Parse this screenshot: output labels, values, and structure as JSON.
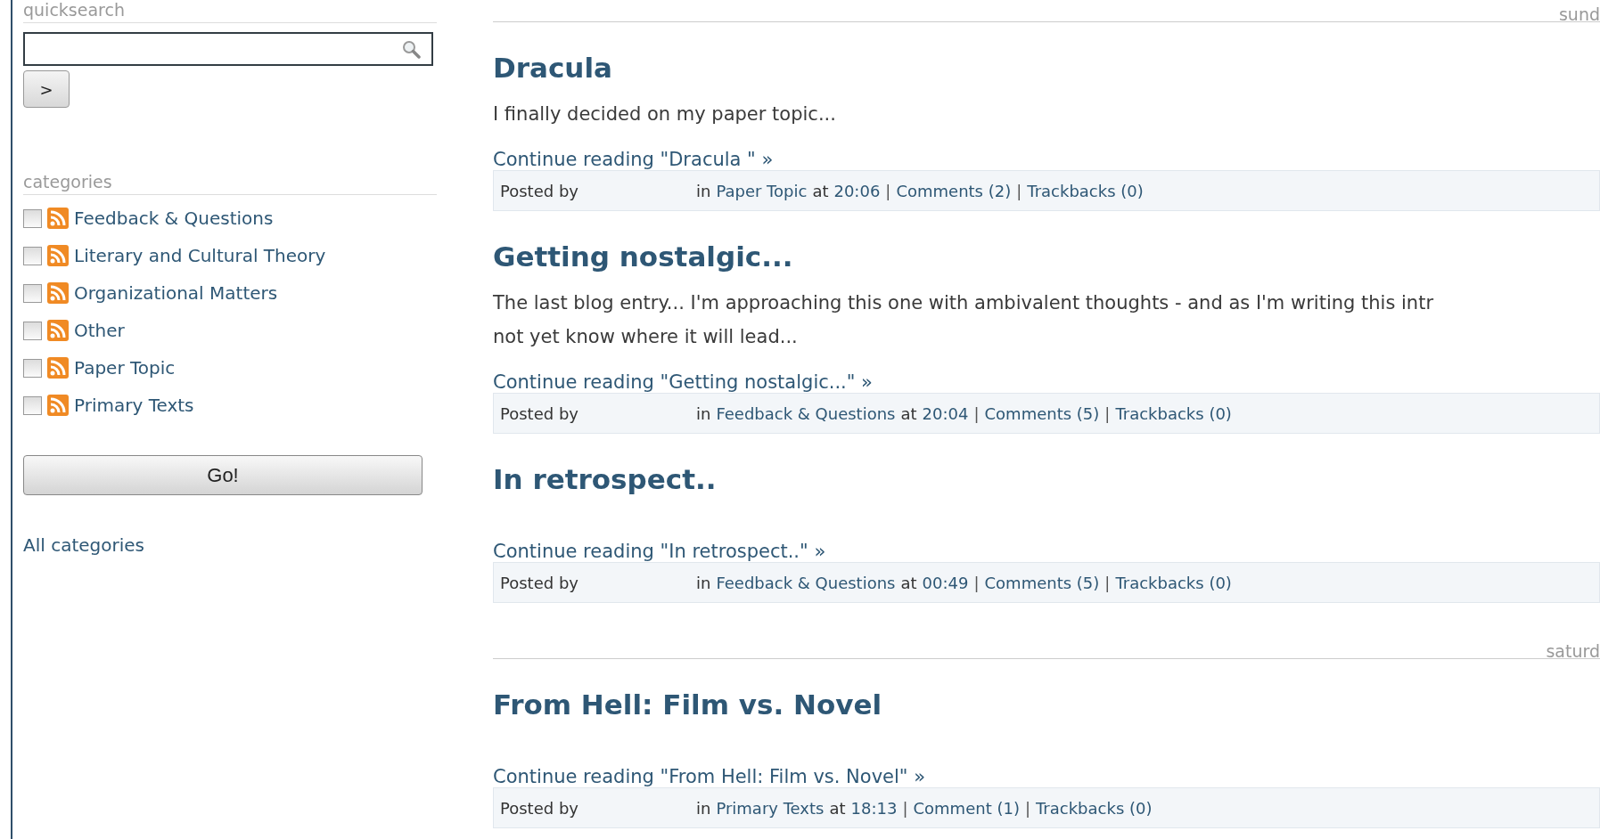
{
  "sidebar": {
    "quicksearch": {
      "heading": "quicksearch",
      "submit_label": ">"
    },
    "categories": {
      "heading": "categories",
      "items": [
        {
          "label": "Feedback & Questions",
          "checked": false
        },
        {
          "label": "Literary and Cultural Theory",
          "checked": false
        },
        {
          "label": "Organizational Matters",
          "checked": false
        },
        {
          "label": "Other",
          "checked": false
        },
        {
          "label": "Paper Topic",
          "checked": false
        },
        {
          "label": "Primary Texts",
          "checked": false
        }
      ],
      "go_label": "Go!",
      "all_link": "All categories"
    }
  },
  "days": [
    {
      "label": "sund",
      "posts": [
        {
          "title": "Dracula",
          "excerpt": [
            "I finally decided on my paper topic..."
          ],
          "continue": "Continue reading \"Dracula \" »",
          "meta": [
            {
              "kind": "text",
              "text": "Posted by"
            },
            {
              "kind": "text",
              "text": "in"
            },
            {
              "kind": "link",
              "text": "Paper Topic"
            },
            {
              "kind": "text",
              "text": "at"
            },
            {
              "kind": "link",
              "text": "20:06"
            },
            {
              "kind": "sep",
              "text": "|"
            },
            {
              "kind": "link",
              "text": "Comments (2)"
            },
            {
              "kind": "sep",
              "text": "|"
            },
            {
              "kind": "link",
              "text": "Trackbacks (0)"
            }
          ]
        },
        {
          "title": "Getting nostalgic...",
          "excerpt": [
            "The last blog entry... I'm approaching this one with ambivalent thoughts - and as I'm writing this intr",
            "not yet know where it will lead..."
          ],
          "continue": "Continue reading \"Getting nostalgic...\" »",
          "meta": [
            {
              "kind": "text",
              "text": "Posted by"
            },
            {
              "kind": "text",
              "text": "in"
            },
            {
              "kind": "link",
              "text": "Feedback & Questions"
            },
            {
              "kind": "text",
              "text": "at"
            },
            {
              "kind": "link",
              "text": "20:04"
            },
            {
              "kind": "sep",
              "text": "|"
            },
            {
              "kind": "link",
              "text": "Comments (5)"
            },
            {
              "kind": "sep",
              "text": "|"
            },
            {
              "kind": "link",
              "text": "Trackbacks (0)"
            }
          ]
        },
        {
          "title": "In retrospect..",
          "continue": "Continue reading \"In retrospect..\" »",
          "meta": [
            {
              "kind": "text",
              "text": "Posted by"
            },
            {
              "kind": "text",
              "text": "in"
            },
            {
              "kind": "link",
              "text": "Feedback & Questions"
            },
            {
              "kind": "text",
              "text": "at"
            },
            {
              "kind": "link",
              "text": "00:49"
            },
            {
              "kind": "sep",
              "text": "|"
            },
            {
              "kind": "link",
              "text": "Comments (5)"
            },
            {
              "kind": "sep",
              "text": "|"
            },
            {
              "kind": "link",
              "text": "Trackbacks (0)"
            }
          ]
        }
      ]
    },
    {
      "label": "saturd",
      "posts": [
        {
          "title": "From Hell: Film vs. Novel",
          "continue": "Continue reading \"From Hell: Film vs. Novel\" »",
          "meta": [
            {
              "kind": "text",
              "text": "Posted by"
            },
            {
              "kind": "text",
              "text": "in"
            },
            {
              "kind": "link",
              "text": "Primary Texts"
            },
            {
              "kind": "text",
              "text": "at"
            },
            {
              "kind": "link",
              "text": "18:13"
            },
            {
              "kind": "sep",
              "text": "|"
            },
            {
              "kind": "link",
              "text": "Comment (1)"
            },
            {
              "kind": "sep",
              "text": "|"
            },
            {
              "kind": "link",
              "text": "Trackbacks (0)"
            }
          ]
        }
      ]
    }
  ]
}
